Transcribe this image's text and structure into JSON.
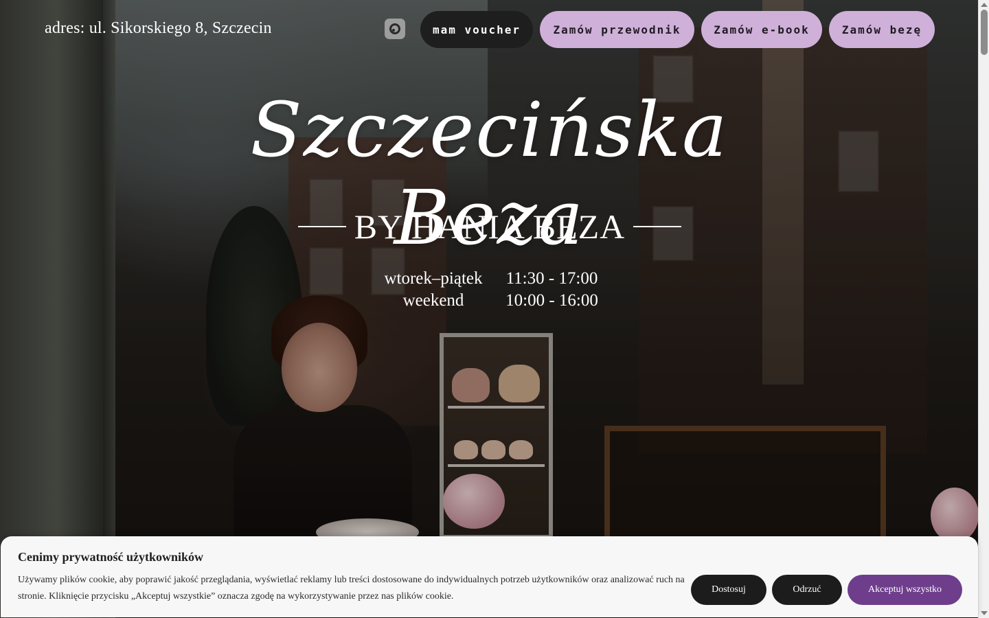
{
  "header": {
    "address": "adres: ul. Sikorskiego 8, Szczecin",
    "instagram_icon": "instagram-icon",
    "buttons": {
      "voucher": "mam voucher",
      "guide": "Zamów przewodnik",
      "ebook": "Zamów e-book",
      "beza": "Zamów bezę"
    }
  },
  "hero": {
    "title": "Szczecińska Beza",
    "byline": "BY HANIA BEZA",
    "hours": [
      {
        "day": "wtorek–piątek",
        "time": "11:30 - 17:00"
      },
      {
        "day": "weekend",
        "time": "10:00 - 16:00"
      }
    ]
  },
  "cookie_banner": {
    "title": "Cenimy prywatność użytkowników",
    "text": "Używamy plików cookie, aby poprawić jakość przeglądania, wyświetlać reklamy lub treści dostosowane do indywidualnych potrzeb użytkowników oraz analizować ruch na stronie. Kliknięcie przycisku „Akceptuj wszystkie” oznacza zgodę na wykorzystywanie przez nas plików cookie.",
    "buttons": {
      "customize": "Dostosuj",
      "reject": "Odrzuć",
      "accept": "Akceptuj wszystko"
    }
  },
  "colors": {
    "nav_purple": "#cfb0d9",
    "nav_dark": "#1e1e1e",
    "accept_purple": "#6e3e8c",
    "banner_bg": "#f7f7f7"
  }
}
